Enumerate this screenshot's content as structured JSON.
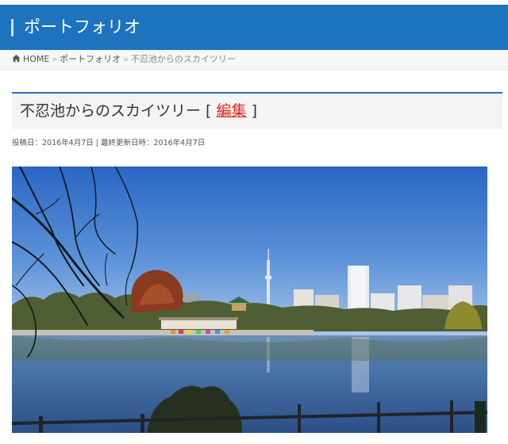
{
  "site": {
    "title": "ポートフォリオ"
  },
  "breadcrumb": {
    "home_label": "HOME",
    "separator": "»",
    "section": "ポートフォリオ",
    "current": "不忍池からのスカイツリー"
  },
  "post": {
    "title": "不忍池からのスカイツリー",
    "edit_open": " [ ",
    "edit_label": "編集",
    "edit_close": " ]",
    "meta": "投稿日：2016年4月7日 | 最終更新日時：2016年4月7日"
  },
  "colors": {
    "header_bg": "#1e73be",
    "edit_link": "#d42a1f",
    "sky_top": "#2f6dc9",
    "water": "#3d6faa"
  },
  "icons": {
    "home": "home-icon"
  }
}
